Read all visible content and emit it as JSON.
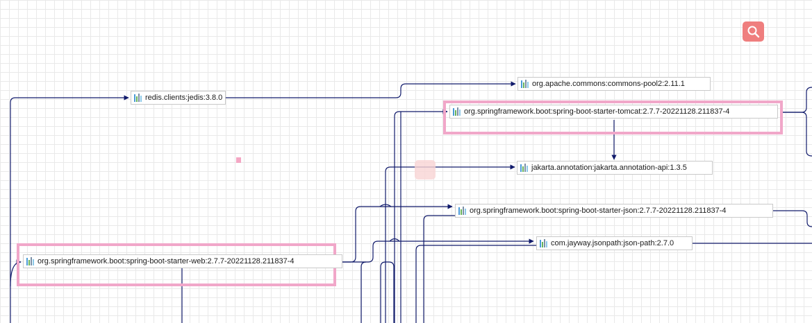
{
  "diagram": {
    "nodes": [
      {
        "id": "jedis",
        "label": "redis.clients:jedis:3.8.0",
        "icon": "maven-dependency-icon"
      },
      {
        "id": "commons_pool2",
        "label": "org.apache.commons:commons-pool2:2.11.1",
        "icon": "maven-dependency-icon"
      },
      {
        "id": "starter_tomcat",
        "label": "org.springframework.boot:spring-boot-starter-tomcat:2.7.7-20221128.211837-4",
        "icon": "maven-dependency-icon",
        "highlighted": true
      },
      {
        "id": "annotation_api",
        "label": "jakarta.annotation:jakarta.annotation-api:1.3.5",
        "icon": "maven-dependency-icon"
      },
      {
        "id": "starter_json",
        "label": "org.springframework.boot:spring-boot-starter-json:2.7.7-20221128.211837-4",
        "icon": "maven-dependency-icon"
      },
      {
        "id": "json_path",
        "label": "com.jayway.jsonpath:json-path:2.7.0",
        "icon": "maven-dependency-icon"
      },
      {
        "id": "starter_web",
        "label": "org.springframework.boot:spring-boot-starter-web:2.7.7-20221128.211837-4",
        "icon": "maven-dependency-icon",
        "highlighted": true
      }
    ],
    "colors": {
      "edge": "#101a6b",
      "highlight": "#f1a7c9",
      "node_border": "#c9c9c9",
      "search_button": "#ef7e7e"
    }
  },
  "toolbar": {
    "search_icon": "search-icon"
  }
}
